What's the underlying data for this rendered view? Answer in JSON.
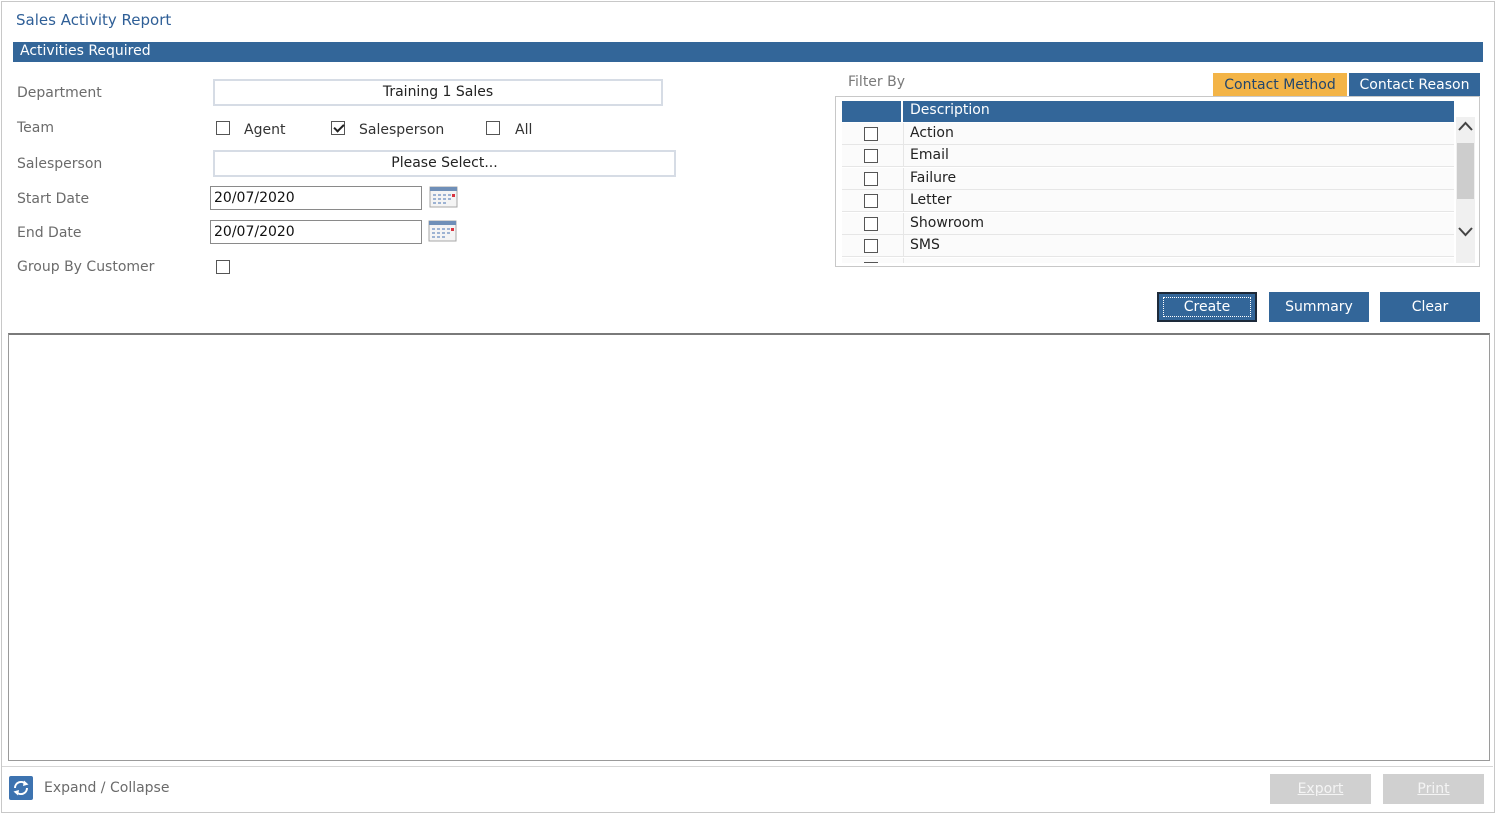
{
  "app": {
    "title": "Sales Activity Report"
  },
  "section": {
    "title": "Activities Required"
  },
  "form": {
    "department_label": "Department",
    "department_value": "Training 1 Sales",
    "team_label": "Team",
    "team_options": [
      {
        "label": "Agent",
        "checked": false
      },
      {
        "label": "Salesperson",
        "checked": true
      },
      {
        "label": "All",
        "checked": false
      }
    ],
    "salesperson_label": "Salesperson",
    "salesperson_value": "Please Select...",
    "start_date_label": "Start Date",
    "start_date_value": "20/07/2020",
    "end_date_label": "End Date",
    "end_date_value": "20/07/2020",
    "group_by_label": "Group By Customer",
    "group_by_checked": false,
    "calendar_icon": "calendar-icon"
  },
  "filter": {
    "label": "Filter By",
    "tabs": [
      {
        "label": "Contact Method",
        "active": true
      },
      {
        "label": "Contact Reason",
        "active": false
      }
    ],
    "grid": {
      "header": "Description",
      "rows": [
        {
          "label": "Action",
          "checked": false
        },
        {
          "label": "Email",
          "checked": false
        },
        {
          "label": "Failure",
          "checked": false
        },
        {
          "label": "Letter",
          "checked": false
        },
        {
          "label": "Showroom",
          "checked": false
        },
        {
          "label": "SMS",
          "checked": false
        },
        {
          "label": "",
          "checked": false
        }
      ]
    }
  },
  "actions": {
    "create": "Create",
    "summary": "Summary",
    "clear": "Clear"
  },
  "footer": {
    "expand_label": "Expand / Collapse",
    "expand_icon": "refresh-icon",
    "export": "Export",
    "print": "Print"
  },
  "colors": {
    "primary": "#336699",
    "accent": "#f3b447",
    "title_text": "#2f5f97",
    "label_text": "#6b6b6b",
    "disabled": "#d0d0d0"
  }
}
